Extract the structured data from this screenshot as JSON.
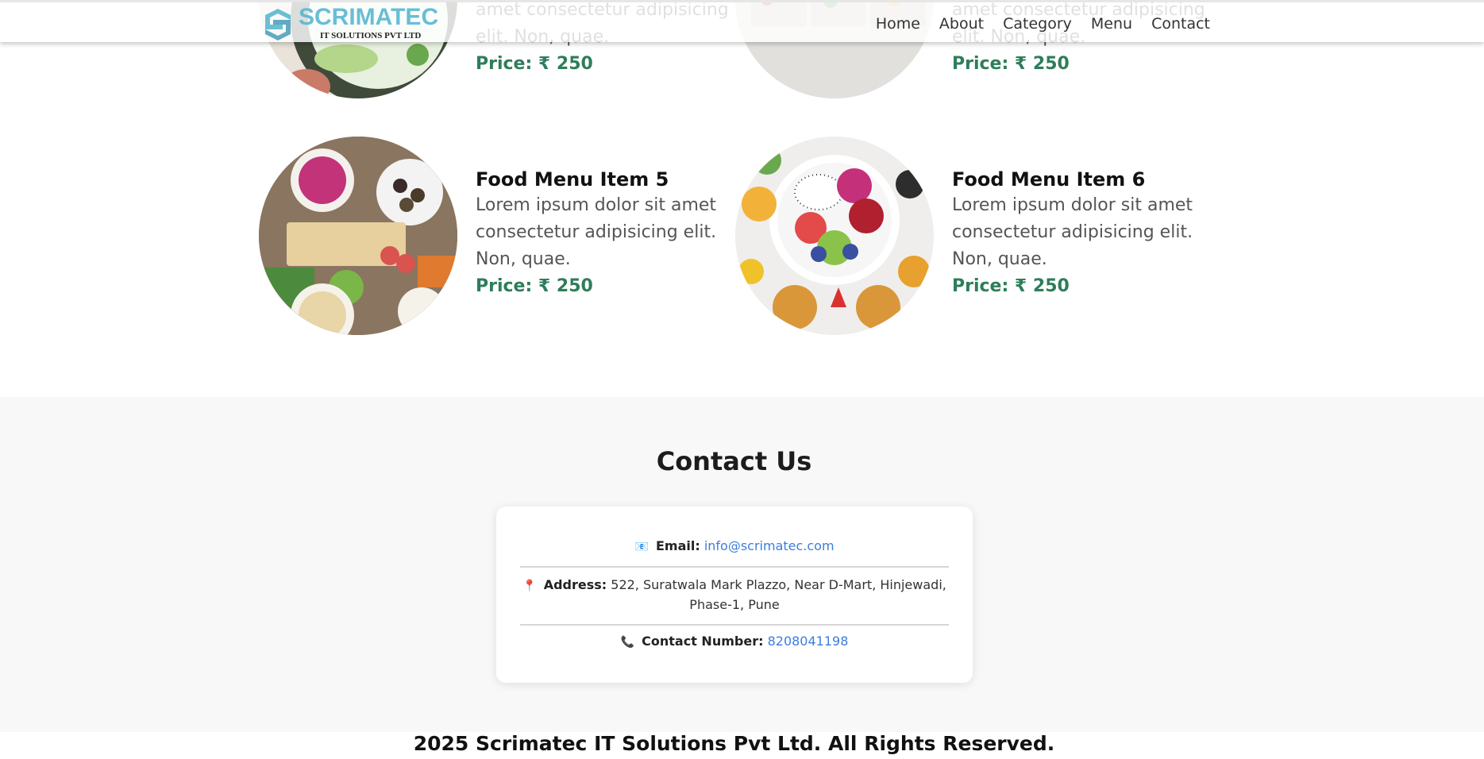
{
  "brand": {
    "name": "SCRIMATEC",
    "subtitle": "IT SOLUTIONS PVT LTD"
  },
  "nav": {
    "items": [
      "Home",
      "About",
      "Category",
      "Menu",
      "Contact"
    ]
  },
  "menu_items": [
    {
      "title": "",
      "desc": "amet consectetur adipisicing elit. Non, quae.",
      "price": "Price: ₹ 250"
    },
    {
      "title": "",
      "desc": "amet consectetur adipisicing elit. Non, quae.",
      "price": "Price: ₹ 250"
    },
    {
      "title": "Food Menu Item 5",
      "desc": "Lorem ipsum dolor sit amet consectetur adipisicing elit. Non, quae.",
      "price": "Price: ₹ 250"
    },
    {
      "title": "Food Menu Item 6",
      "desc": "Lorem ipsum dolor sit amet consectetur adipisicing elit. Non, quae.",
      "price": "Price: ₹ 250"
    }
  ],
  "contact": {
    "heading": "Contact Us",
    "email_label": "Email:",
    "email_value": "info@scrimatec.com",
    "address_label": "Address:",
    "address_value": "522, Suratwala Mark Plazzo, Near D-Mart, Hinjewadi, Phase-1, Pune",
    "phone_label": "Contact Number:",
    "phone_value": "8208041198",
    "email_icon": "email-icon",
    "address_icon": "location-pin-icon",
    "phone_icon": "phone-icon"
  },
  "footer": {
    "text": "2025 Scrimatec IT Solutions Pvt Ltd. All Rights Reserved."
  },
  "colors": {
    "price": "#2e7d5b",
    "link": "#3b7de0",
    "brand": "#4fb4cf",
    "contact_bg": "#f8f8f8"
  }
}
